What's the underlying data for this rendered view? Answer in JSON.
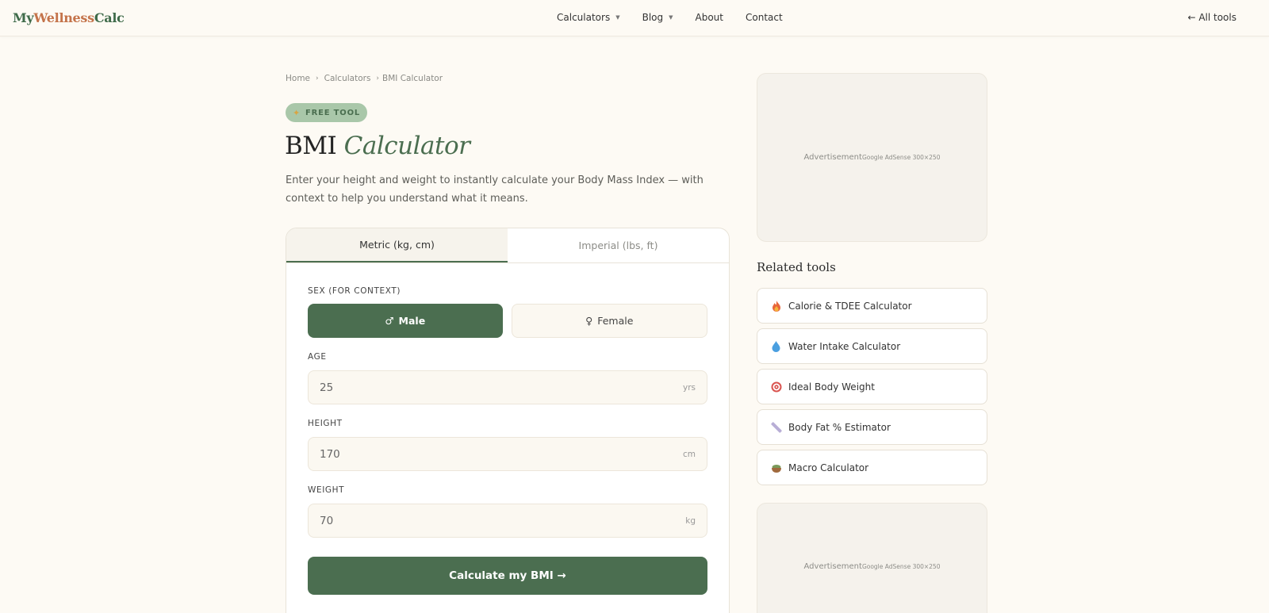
{
  "brand": {
    "part1": "My",
    "part2": "Wellness",
    "part3": "Calc"
  },
  "nav": {
    "items": [
      {
        "label": "Calculators",
        "has_caret": true
      },
      {
        "label": "Blog",
        "has_caret": true
      },
      {
        "label": "About",
        "has_caret": false
      },
      {
        "label": "Contact",
        "has_caret": false
      }
    ],
    "all_tools": "← All tools"
  },
  "breadcrumb": {
    "home": "Home",
    "calculators": "Calculators",
    "current": "BMI Calculator"
  },
  "badge": {
    "label": "FREE TOOL"
  },
  "page": {
    "title_plain": "BMI",
    "title_italic": "Calculator",
    "subtitle": "Enter your height and weight to instantly calculate your Body Mass Index — with context to help you understand what it means."
  },
  "calculator": {
    "tabs": [
      {
        "label": "Metric (kg, cm)",
        "active": true
      },
      {
        "label": "Imperial (lbs, ft)",
        "active": false
      }
    ],
    "sex_label": "SEX (FOR CONTEXT)",
    "male_label": "Male",
    "female_label": "Female",
    "age": {
      "label": "AGE",
      "value": "25",
      "unit": "yrs"
    },
    "height": {
      "label": "HEIGHT",
      "value": "170",
      "unit": "cm"
    },
    "weight": {
      "label": "WEIGHT",
      "value": "70",
      "unit": "kg"
    },
    "submit_label": "Calculate my BMI →"
  },
  "ads": {
    "label": "Advertisement",
    "sub": "Google AdSense 300×250"
  },
  "related": {
    "title": "Related tools",
    "items": [
      {
        "label": "Calorie & TDEE Calculator",
        "icon": "fire-icon"
      },
      {
        "label": "Water Intake Calculator",
        "icon": "droplet-icon"
      },
      {
        "label": "Ideal Body Weight",
        "icon": "target-icon"
      },
      {
        "label": "Body Fat % Estimator",
        "icon": "ruler-icon"
      },
      {
        "label": "Macro Calculator",
        "icon": "food-bowl-icon"
      }
    ]
  },
  "colors": {
    "primary_green": "#4b6e50",
    "accent_orange": "#c4734a",
    "background": "#fdfaf4",
    "badge_green": "#a9c7a9"
  }
}
